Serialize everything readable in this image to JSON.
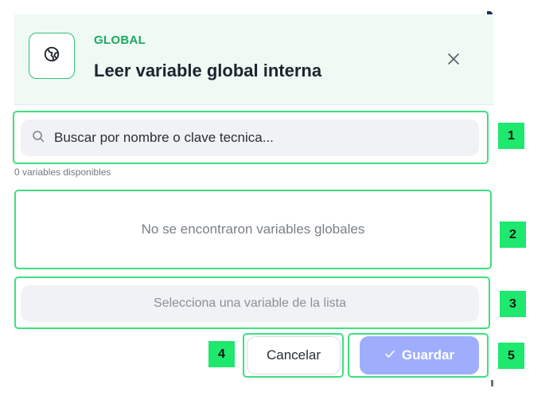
{
  "dialog": {
    "eyebrow": "GLOBAL",
    "title": "Leer variable global interna",
    "icon": "globe-icon",
    "close_icon": "close-icon"
  },
  "search": {
    "placeholder": "Buscar por nombre o clave tecnica...",
    "value": "",
    "icon": "search-icon",
    "count_text": "0 variables disponibles"
  },
  "list": {
    "empty_text": "No se encontraron variables globales"
  },
  "selection": {
    "placeholder": "Selecciona una variable de la lista"
  },
  "actions": {
    "cancel_label": "Cancelar",
    "save_label": "Guardar",
    "save_icon": "check-icon"
  },
  "annotations": [
    "1",
    "2",
    "3",
    "4",
    "5"
  ],
  "colors": {
    "accent_green": "#1fa862",
    "header_bg": "#eefaf3",
    "frame_green": "#3ee07f",
    "badge_green": "#1ee86e",
    "save_button": "#9eaefc"
  }
}
